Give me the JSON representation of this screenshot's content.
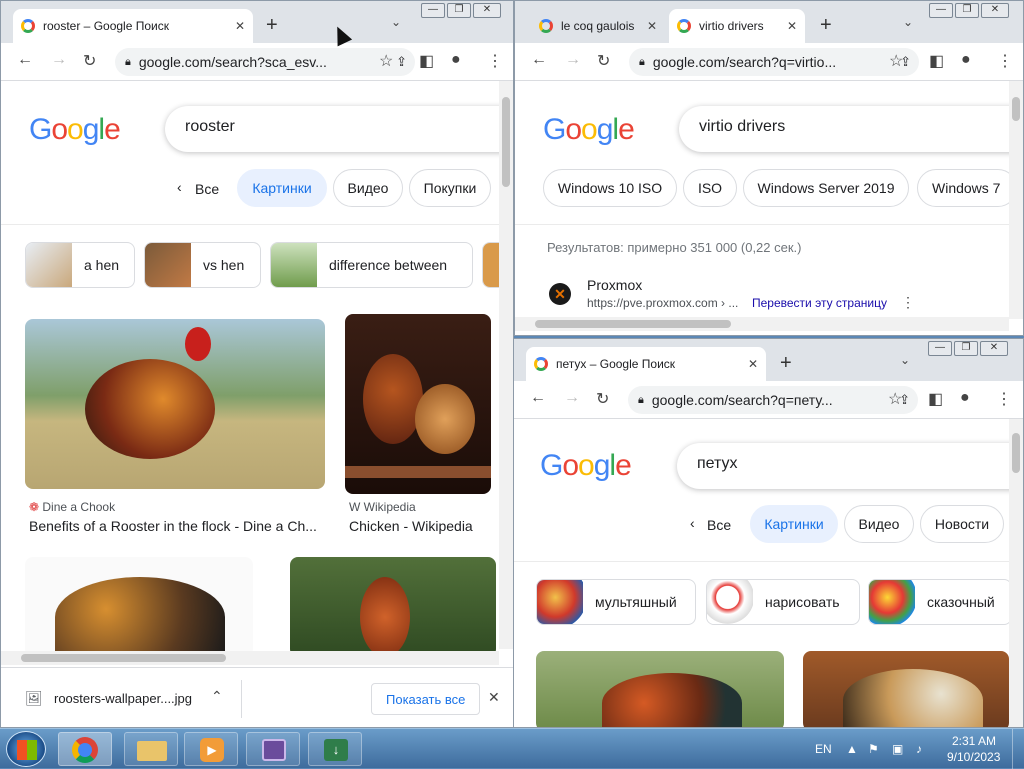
{
  "win1": {
    "tab_title": "rooster – Google Поиск",
    "url": "google.com/search?sca_esv...",
    "query": "rooster",
    "chips": {
      "back": "Все",
      "images": "Картинки",
      "video": "Видео",
      "shopping": "Покупки"
    },
    "suggestions": [
      "a hen",
      "vs hen",
      "difference between"
    ],
    "results": [
      {
        "source": "Dine a Chook",
        "title": "Benefits of a Rooster in the flock - Dine a Ch..."
      },
      {
        "source": "Wikipedia",
        "title": "Chicken - Wikipedia"
      }
    ],
    "download": {
      "file": "roosters-wallpaper....jpg",
      "show_all": "Показать все"
    }
  },
  "win2": {
    "tab1_title": "le coq gaulois",
    "tab2_title": "virtio drivers",
    "url": "google.com/search?q=virtio...",
    "query": "virtio drivers",
    "chips": [
      "Windows 10 ISO",
      "ISO",
      "Windows Server 2019",
      "Windows 7"
    ],
    "stats": "Результатов: примерно 351 000 (0,22 сек.)",
    "result": {
      "title": "Proxmox",
      "url": "https://pve.proxmox.com › ...",
      "translate": "Перевести эту страницу"
    }
  },
  "win3": {
    "tab_title": "петух – Google Поиск",
    "url": "google.com/search?q=пету...",
    "query": "петух",
    "chips": {
      "back": "Все",
      "images": "Картинки",
      "video": "Видео",
      "news": "Новости"
    },
    "suggestions": [
      "мультяшный",
      "нарисовать",
      "сказочный"
    ]
  },
  "logo": {
    "g1": "G",
    "o1": "o",
    "o2": "o",
    "g2": "g",
    "l": "l",
    "e": "e"
  },
  "taskbar": {
    "lang": "EN",
    "time": "2:31 AM",
    "date": "9/10/2023"
  },
  "colors": {
    "blue": "#4285f4",
    "red": "#ea4335",
    "yellow": "#fbbc05",
    "green": "#34a853",
    "taskbar": "#3e6c9d"
  },
  "icons": [
    "back-arrow-icon",
    "forward-arrow-icon",
    "reload-icon",
    "lock-icon",
    "share-icon",
    "star-icon",
    "side-panel-icon",
    "profile-icon",
    "menu-dots-icon",
    "close-icon",
    "chevron-icon",
    "plus-icon"
  ]
}
